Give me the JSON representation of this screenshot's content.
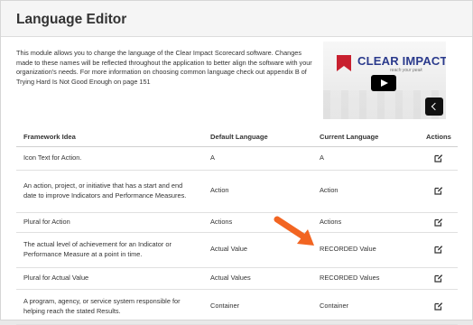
{
  "page": {
    "title": "Language Editor",
    "intro": "This module allows you to change the language of the Clear Impact Scorecard software. Changes made to these names will be reflected throughout the application to better align the software with your organization's needs. For more information on choosing common language check out appendix B of Trying Hard Is Not Good Enough on page 151"
  },
  "video": {
    "logo_text_a": "CLEAR ",
    "logo_text_b": "IMPACT",
    "logo_tagline": "reach your peak",
    "play_icon": "play-icon",
    "prev_icon": "chevron-left-icon"
  },
  "table": {
    "headers": {
      "idea": "Framework Idea",
      "default": "Default Language",
      "current": "Current Language",
      "actions": "Actions"
    },
    "rows": [
      {
        "idea": "Icon Text for Action.",
        "default": "A",
        "current": "A"
      },
      {
        "idea": "An action, project, or initiative that has a start and end date to improve Indicators and Performance Measures.",
        "default": "Action",
        "current": "Action"
      },
      {
        "idea": "Plural for Action",
        "default": "Actions",
        "current": "Actions"
      },
      {
        "idea": "The actual level of achievement for an Indicator or Performance Measure at a point in time.",
        "default": "Actual Value",
        "current": "RECORDED Value"
      },
      {
        "idea": "Plural for Actual Value",
        "default": "Actual Values",
        "current": "RECORDED Values"
      },
      {
        "idea": "A program, agency, or service system responsible for helping reach the stated Results.",
        "default": "Container",
        "current": "Container"
      }
    ],
    "action_icon": "edit-icon"
  },
  "colors": {
    "brand_red": "#c8202f",
    "brand_blue": "#2a3a8c",
    "annotation_orange": "#f26522"
  }
}
